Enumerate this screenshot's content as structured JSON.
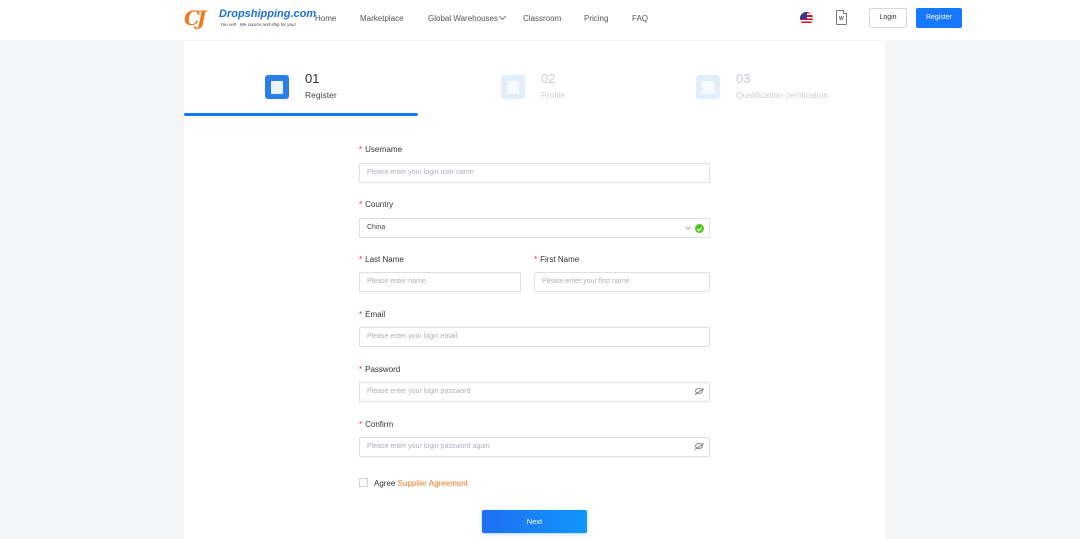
{
  "header": {
    "logo": {
      "cj": "CJ",
      "name": "Dropshipping.com",
      "tagline": "You sell - We source and ship for you!"
    },
    "nav": [
      {
        "label": "Home"
      },
      {
        "label": "Marketplace"
      },
      {
        "label": "Global Warehouses"
      },
      {
        "label": "Classroom"
      },
      {
        "label": "Pricing"
      },
      {
        "label": "FAQ"
      }
    ],
    "language_icon": "us-flag-icon",
    "document_icon": "word-document-icon",
    "login_label": "Login",
    "register_label": "Register"
  },
  "steps": [
    {
      "num": "01",
      "label": "Register",
      "active": true,
      "icon": "user-card-icon"
    },
    {
      "num": "02",
      "label": "Profile",
      "active": false,
      "icon": "document-list-icon"
    },
    {
      "num": "03",
      "label": "Qualification certification",
      "active": false,
      "icon": "certificate-icon"
    }
  ],
  "form": {
    "username": {
      "label": "Username",
      "placeholder": "Please enter your login user name"
    },
    "country": {
      "label": "Country",
      "value": "China"
    },
    "last_name": {
      "label": "Last Name",
      "placeholder": "Please enter name."
    },
    "first_name": {
      "label": "First Name",
      "placeholder": "Please enter your first name"
    },
    "email": {
      "label": "Email",
      "placeholder": "Please enter your login email"
    },
    "password": {
      "label": "Password",
      "placeholder": "Please enter your login password"
    },
    "confirm": {
      "label": "Confirm",
      "placeholder": "Please enter your login password again"
    },
    "required_mark": "*",
    "agree": {
      "text": "Agree",
      "link": "Supplier Agreement"
    },
    "next_label": "Next"
  },
  "colors": {
    "primary": "#1677ff",
    "brand_orange": "#f07a1f",
    "required": "#f5222d",
    "success": "#52c41a"
  }
}
